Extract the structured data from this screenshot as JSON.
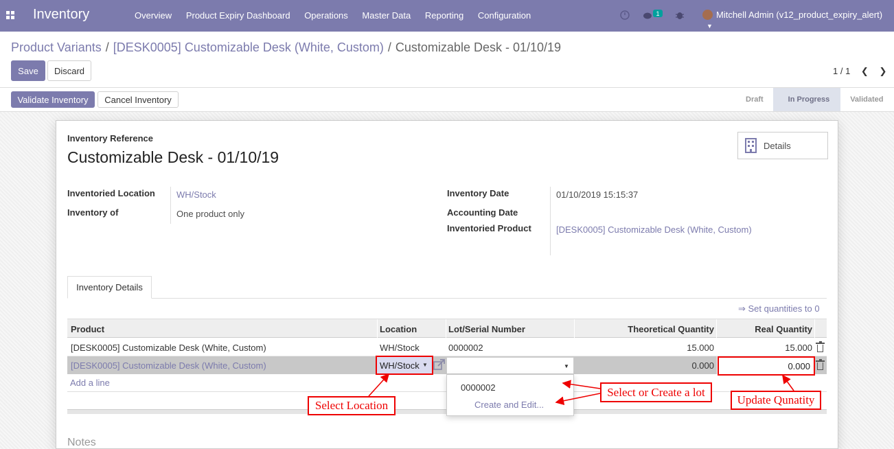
{
  "navbar": {
    "brand": "Inventory",
    "menu": [
      "Overview",
      "Product Expiry Dashboard",
      "Operations",
      "Master Data",
      "Reporting",
      "Configuration"
    ],
    "chat_badge": "1",
    "user": "Mitchell Admin (v12_product_expiry_alert)",
    "color": "#7c7bad"
  },
  "breadcrumb": {
    "items": [
      "Product Variants",
      "[DESK0005] Customizable Desk (White, Custom)"
    ],
    "current": "Customizable Desk - 01/10/19",
    "separator": "/"
  },
  "buttons": {
    "save": "Save",
    "discard": "Discard",
    "validate": "Validate Inventory",
    "cancel": "Cancel Inventory"
  },
  "pager": {
    "value": "1 / 1"
  },
  "status": {
    "steps": [
      "Draft",
      "In Progress",
      "Validated"
    ],
    "active": "In Progress"
  },
  "form": {
    "ref_label": "Inventory Reference",
    "title": "Customizable Desk - 01/10/19",
    "details_button": "Details",
    "location_label": "Inventoried Location",
    "location_value": "WH/Stock",
    "of_label": "Inventory of",
    "of_value": "One product only",
    "date_label": "Inventory Date",
    "date_value": "01/10/2019 15:15:37",
    "accounting_label": "Accounting Date",
    "product_label": "Inventoried Product",
    "product_value": "[DESK0005] Customizable Desk (White, Custom)",
    "notes_label": "Notes"
  },
  "tabs": {
    "details": "Inventory Details"
  },
  "table": {
    "set_zero": "⇒ Set quantities to 0",
    "headers": [
      "Product",
      "Location",
      "Lot/Serial Number",
      "Theoretical Quantity",
      "Real Quantity"
    ],
    "rows": [
      {
        "product": "[DESK0005] Customizable Desk (White, Custom)",
        "location": "WH/Stock",
        "lot": "0000002",
        "theoretical": "15.000",
        "real": "15.000"
      },
      {
        "product": "[DESK0005] Customizable Desk (White, Custom)",
        "location": "WH/Stock",
        "lot": "",
        "theoretical": "0.000",
        "real": "0.000"
      }
    ],
    "add_line": "Add a line",
    "dropdown": [
      "0000002",
      "Create and Edit..."
    ]
  },
  "annotations": {
    "select_location": "Select Location",
    "select_lot": "Select or Create a lot",
    "update_qty": "Update Qunatity",
    "color": "#ee0000"
  }
}
